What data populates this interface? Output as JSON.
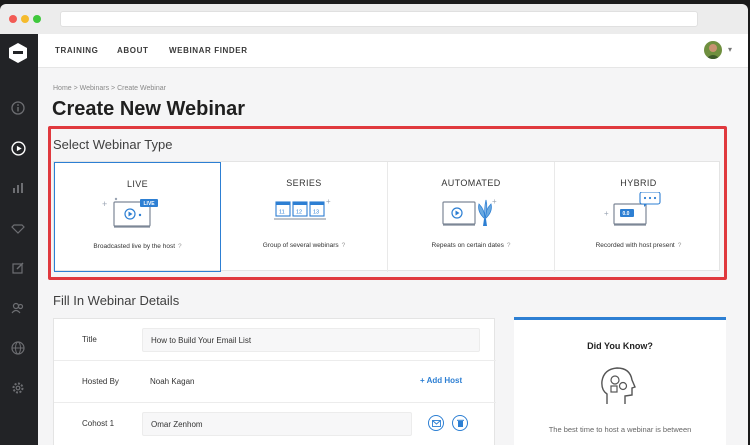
{
  "nav": {
    "training": "TRAINING",
    "about": "ABOUT",
    "webinar_finder": "WEBINAR FINDER"
  },
  "breadcrumb": "Home > Webinars > Create Webinar",
  "page_title": "Create New Webinar",
  "select_type": {
    "heading": "Select Webinar Type",
    "cards": [
      {
        "title": "LIVE",
        "badge": "LIVE",
        "desc": "Broadcasted live by the host",
        "selected": true
      },
      {
        "title": "SERIES",
        "dates": [
          "11",
          "12",
          "13"
        ],
        "desc": "Group of several webinars",
        "selected": false
      },
      {
        "title": "AUTOMATED",
        "desc": "Repeats on certain dates",
        "selected": false
      },
      {
        "title": "HYBRID",
        "badge": "0.0",
        "desc": "Recorded with host present",
        "selected": false
      }
    ],
    "help_glyph": "?"
  },
  "details": {
    "heading": "Fill In Webinar Details",
    "title_label": "Title",
    "title_value": "How to Build Your Email List",
    "hosted_by_label": "Hosted By",
    "hosted_by_value": "Noah Kagan",
    "add_host": "+ Add Host",
    "cohost_label": "Cohost 1",
    "cohost_value": "Omar Zenhom"
  },
  "did_you_know": {
    "title": "Did You Know?",
    "text": "The best time to host a webinar is between"
  },
  "colors": {
    "accent": "#2d7fd3",
    "highlight_red": "#e0393e",
    "sidebar": "#222326"
  }
}
